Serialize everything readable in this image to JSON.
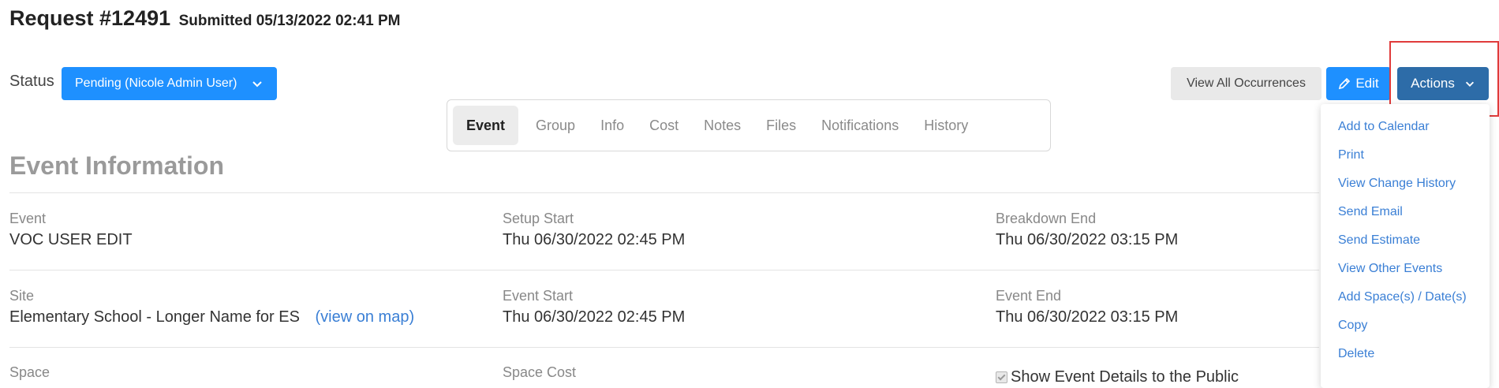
{
  "header": {
    "title": "Request #12491",
    "submitted": "Submitted 05/13/2022 02:41 PM"
  },
  "status": {
    "label": "Status",
    "value": "Pending (Nicole Admin User)"
  },
  "toolbar": {
    "view_all_occurrences": "View All Occurrences",
    "edit": "Edit",
    "actions": "Actions"
  },
  "tabs": [
    {
      "label": "Event",
      "active": true
    },
    {
      "label": "Group"
    },
    {
      "label": "Info"
    },
    {
      "label": "Cost"
    },
    {
      "label": "Notes"
    },
    {
      "label": "Files"
    },
    {
      "label": "Notifications"
    },
    {
      "label": "History"
    }
  ],
  "section": {
    "title": "Event Information"
  },
  "fields": {
    "event": {
      "label": "Event",
      "value": "VOC USER EDIT"
    },
    "setup_start": {
      "label": "Setup Start",
      "value": "Thu 06/30/2022 02:45 PM"
    },
    "breakdown_end": {
      "label": "Breakdown End",
      "value": "Thu 06/30/2022 03:15 PM"
    },
    "site": {
      "label": "Site",
      "value": "Elementary School - Longer Name for ES",
      "link": "(view on map)"
    },
    "event_start": {
      "label": "Event Start",
      "value": "Thu 06/30/2022 02:45 PM"
    },
    "event_end": {
      "label": "Event End",
      "value": "Thu 06/30/2022 03:15 PM"
    },
    "space": {
      "label": "Space"
    },
    "space_cost": {
      "label": "Space Cost"
    },
    "show_public": {
      "label": "Show Event Details to the Public",
      "checked": true
    }
  },
  "actions_menu": [
    "Add to Calendar",
    "Print",
    "View Change History",
    "Send Email",
    "Send Estimate",
    "View Other Events",
    "Add Space(s) / Date(s)",
    "Copy",
    "Delete"
  ],
  "colors": {
    "primary": "#1e90ff",
    "actions": "#2d6ca8",
    "link": "#3a7fd5",
    "highlight": "#e03b3b"
  }
}
